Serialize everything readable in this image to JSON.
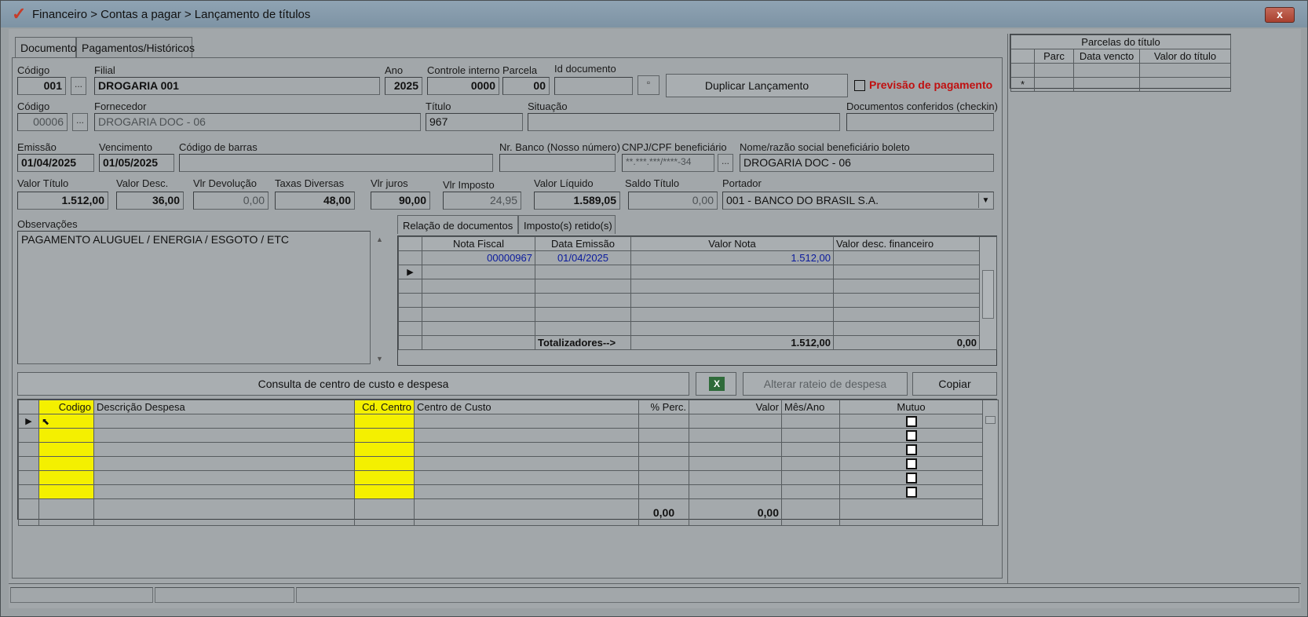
{
  "window": {
    "title": "Financeiro > Contas a pagar > Lançamento de títulos",
    "close_label": "x"
  },
  "tabs": [
    "Documento",
    "Pagamentos/Históricos"
  ],
  "labels": {
    "codigo": "Código",
    "filial": "Filial",
    "ano": "Ano",
    "controle_interno": "Controle interno",
    "parcela": "Parcela",
    "id_documento": "Id documento",
    "codigo2": "Código",
    "fornecedor": "Fornecedor",
    "titulo": "Título",
    "situacao": "Situação",
    "docs_conferidos": "Documentos conferidos (checkin)",
    "emissao": "Emissão",
    "vencimento": "Vencimento",
    "codigo_barras": "Código de barras",
    "nr_banco": "Nr. Banco (Nosso número)",
    "cnpj": "CNPJ/CPF beneficiário",
    "nome_beneficiario": "Nome/razão social beneficiário boleto",
    "valor_titulo": "Valor Título",
    "valor_desc": "Valor Desc.",
    "vlr_devolucao": "Vlr Devolução",
    "taxas_diversas": "Taxas Diversas",
    "vlr_juros": "Vlr juros",
    "vlr_imposto": "Vlr Imposto",
    "valor_liquido": "Valor Líquido",
    "saldo_titulo": "Saldo Título",
    "portador": "Portador",
    "observacoes": "Observações"
  },
  "fields": {
    "codigo": "001",
    "filial": "DROGARIA 001",
    "ano": "2025",
    "controle_interno": "0000",
    "parcela": "00",
    "id_documento": "",
    "codigo2": "00006",
    "fornecedor": "DROGARIA DOC - 06",
    "titulo": "967",
    "situacao": "",
    "docs_conferidos": "",
    "emissao": "01/04/2025",
    "vencimento": "01/05/2025",
    "codigo_barras": "",
    "nr_banco": "",
    "cnpj": "**.***.***/****-34",
    "nome_beneficiario": "DROGARIA DOC - 06",
    "valor_titulo": "1.512,00",
    "valor_desc": "36,00",
    "vlr_devolucao": "0,00",
    "taxas_diversas": "48,00",
    "vlr_juros": "90,00",
    "vlr_imposto": "24,95",
    "valor_liquido": "1.589,05",
    "saldo_titulo": "0,00",
    "portador": "001 - BANCO DO BRASIL S.A.",
    "observacoes": "PAGAMENTO ALUGUEL / ENERGIA / ESGOTO / ETC"
  },
  "buttons": {
    "browse": "...",
    "duplicar": "Duplicar Lançamento",
    "consulta": "Consulta de centro de custo e despesa",
    "alterar_rateio": "Alterar rateio de despesa",
    "copiar": "Copiar"
  },
  "previsao_label": "Previsão de pagamento",
  "doc_tabs": [
    "Relação de documentos",
    "Imposto(s) retido(s)"
  ],
  "doc_grid": {
    "headers": [
      "Nota Fiscal",
      "Data Emissão",
      "Valor Nota",
      "Valor desc. financeiro"
    ],
    "row": [
      "00000967",
      "01/04/2025",
      "1.512,00",
      ""
    ],
    "totals_label": "Totalizadores-->",
    "total_valor": "1.512,00",
    "total_desc": "0,00"
  },
  "expense_grid": {
    "headers": [
      "Codigo",
      "Descrição Despesa",
      "Cd. Centro",
      "Centro de Custo",
      "% Perc.",
      "Valor",
      "Mês/Ano",
      "Mutuo"
    ],
    "total_perc": "0,00",
    "total_valor": "0,00"
  },
  "parcelas": {
    "title": "Parcelas do título",
    "headers": [
      "Parc",
      "Data vencto",
      "Valor do título"
    ],
    "new_row_marker": "*"
  }
}
